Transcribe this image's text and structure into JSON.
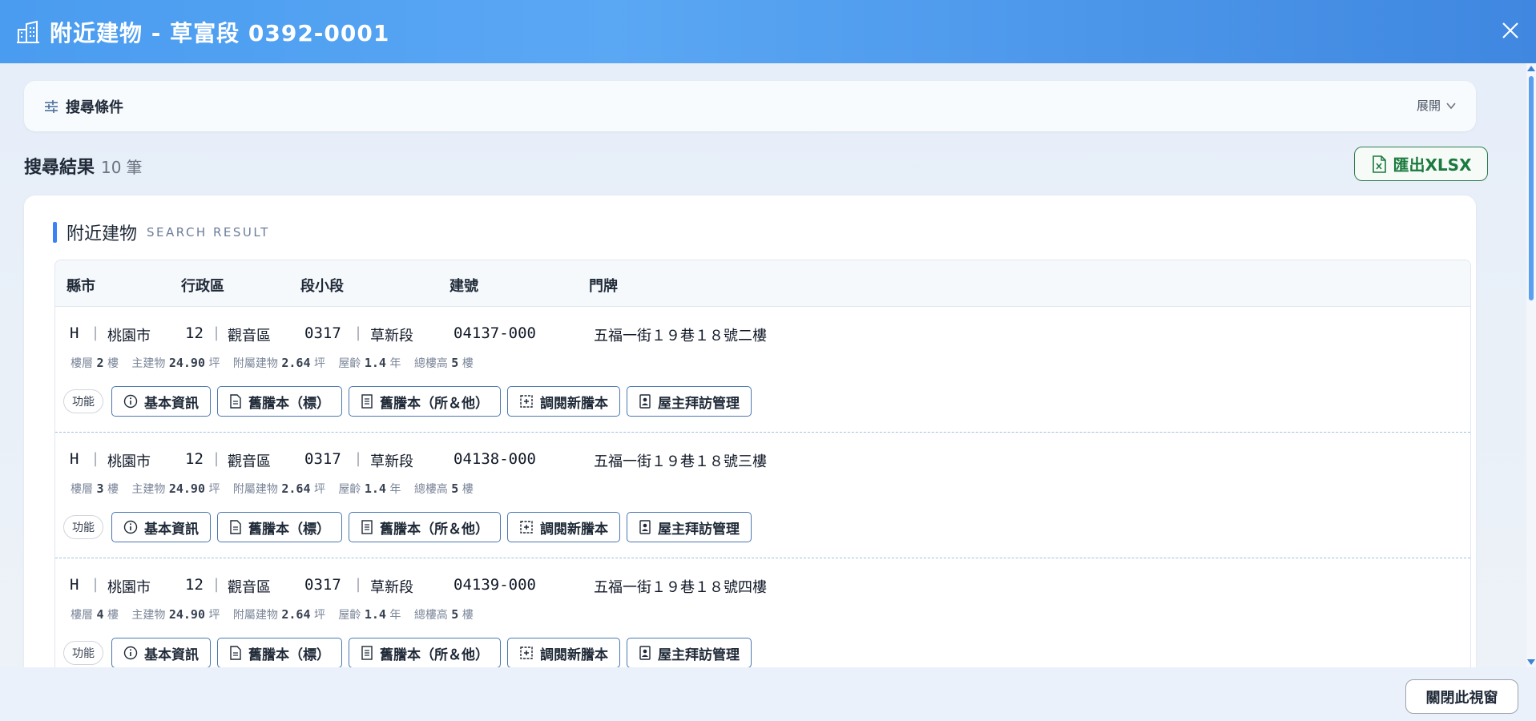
{
  "header": {
    "title": "附近建物 - 草富段 0392-0001"
  },
  "filter": {
    "title": "搜尋條件",
    "expand_label": "展開"
  },
  "results": {
    "title": "搜尋結果",
    "count": "10",
    "unit": "筆"
  },
  "export": {
    "label": "匯出XLSX"
  },
  "card": {
    "title": "附近建物",
    "subtitle": "SEARCH RESULT"
  },
  "columns": [
    "縣市",
    "行政區",
    "段小段",
    "建號",
    "門牌"
  ],
  "labels": {
    "floor": "樓層",
    "floor_unit": "樓",
    "main": "主建物",
    "area_unit": "坪",
    "attached": "附屬建物",
    "age": "屋齡",
    "age_unit": "年",
    "total": "總樓高",
    "func": "功能",
    "sep": "|"
  },
  "actions": [
    "基本資訊",
    "舊謄本（標）",
    "舊謄本（所＆他）",
    "調閱新謄本",
    "屋主拜訪管理"
  ],
  "rows": [
    {
      "city_code": "H",
      "city": "桃園市",
      "dist_code": "12",
      "dist": "觀音區",
      "sec_code": "0317",
      "sec": "草新段",
      "build_no": "04137-000",
      "address": "五福一街１９巷１８號二樓",
      "floor": "2",
      "main_area": "24.90",
      "attached_area": "2.64",
      "age": "1.4",
      "total_floors": "5"
    },
    {
      "city_code": "H",
      "city": "桃園市",
      "dist_code": "12",
      "dist": "觀音區",
      "sec_code": "0317",
      "sec": "草新段",
      "build_no": "04138-000",
      "address": "五福一街１９巷１８號三樓",
      "floor": "3",
      "main_area": "24.90",
      "attached_area": "2.64",
      "age": "1.4",
      "total_floors": "5"
    },
    {
      "city_code": "H",
      "city": "桃園市",
      "dist_code": "12",
      "dist": "觀音區",
      "sec_code": "0317",
      "sec": "草新段",
      "build_no": "04139-000",
      "address": "五福一街１９巷１８號四樓",
      "floor": "4",
      "main_area": "24.90",
      "attached_area": "2.64",
      "age": "1.4",
      "total_floors": "5"
    }
  ],
  "footer": {
    "close_label": "關閉此視窗"
  },
  "colors": {
    "header_start": "#4a9cf0",
    "header_end": "#3f87e0",
    "accent": "#3b82f6",
    "export_green": "#1b7a3e",
    "button_border": "#4a78b0"
  }
}
